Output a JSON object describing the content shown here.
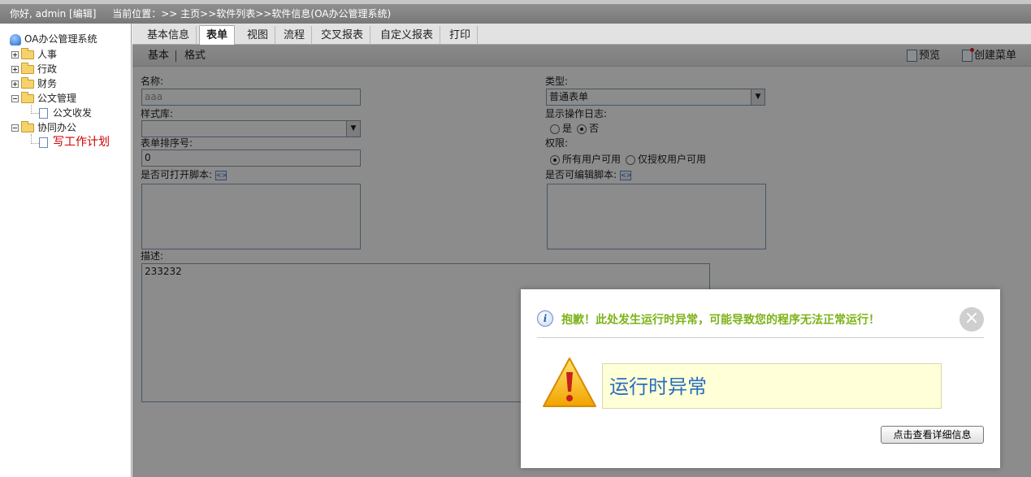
{
  "topbar": {
    "greeting": "你好, admin [编辑]",
    "location": "当前位置：>> 主页>>软件列表>>软件信息(OA办公管理系统)"
  },
  "sidebar": {
    "root": "OA办公管理系统",
    "items": [
      {
        "label": "人事",
        "expanded": false
      },
      {
        "label": "行政",
        "expanded": false
      },
      {
        "label": "财务",
        "expanded": false
      },
      {
        "label": "公文管理",
        "expanded": true
      },
      {
        "label": "公文收发",
        "type": "doc"
      },
      {
        "label": "协同办公",
        "expanded": true
      },
      {
        "label": "写工作计划",
        "type": "doc",
        "selected": true
      }
    ]
  },
  "tabs": [
    "基本信息",
    "表单",
    "视图",
    "流程",
    "交叉报表",
    "自定义报表",
    "打印"
  ],
  "active_tab": "表单",
  "subtabs": [
    "基本",
    "格式"
  ],
  "toolbar": {
    "preview": "预览",
    "create_menu": "创建菜单"
  },
  "form": {
    "name_label": "名称:",
    "name_value": "aaa",
    "type_label": "类型:",
    "type_value": "普通表单",
    "style_label": "样式库:",
    "style_value": "",
    "showlog_label": "显示操作日志:",
    "showlog_options": [
      "是",
      "否"
    ],
    "showlog_selected": "否",
    "order_label": "表单排序号:",
    "order_value": "0",
    "perm_label": "权限:",
    "perm_options": [
      "所有用户可用",
      "仅授权用户可用"
    ],
    "perm_selected": "所有用户可用",
    "open_script_label": "是否可打开脚本:",
    "edit_script_label": "是否可编辑脚本:",
    "desc_label": "描述:",
    "desc_value": "233232"
  },
  "dialog": {
    "title": "抱歉！此处发生运行时异常，可能导致您的程序无法正常运行！",
    "message": "运行时异常",
    "detail_button": "点击查看详细信息",
    "close_symbol": "×"
  },
  "colors": {
    "dialog_title": "#7cb318",
    "message_text": "#2a6ebf",
    "message_bg": "#ffffd8",
    "selected_tree_item": "#d10000"
  }
}
